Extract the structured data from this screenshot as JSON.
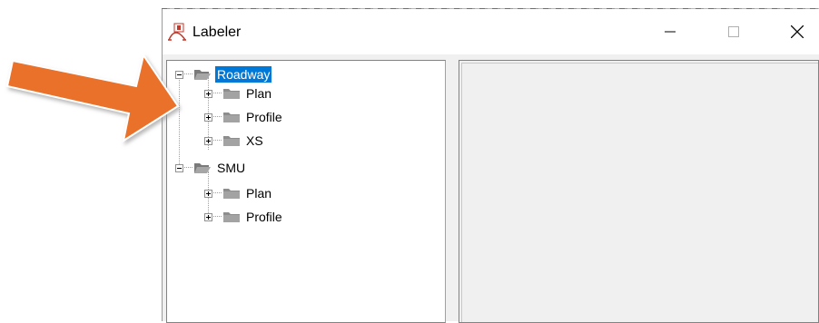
{
  "window": {
    "title": "Labeler",
    "icons": {
      "app": "labeler-app-icon",
      "minimize": "minimize-icon",
      "maximize": "maximize-icon",
      "close": "close-icon"
    }
  },
  "tree": {
    "nodes": [
      {
        "label": "Roadway",
        "selected": true,
        "expanded": true,
        "children": [
          {
            "label": "Plan"
          },
          {
            "label": "Profile"
          },
          {
            "label": "XS"
          }
        ]
      },
      {
        "label": "SMU",
        "expanded": true,
        "children": [
          {
            "label": "Plan"
          },
          {
            "label": "Profile"
          }
        ]
      }
    ]
  },
  "colors": {
    "arrow": "#e9712b",
    "selection": "#0078d7"
  }
}
